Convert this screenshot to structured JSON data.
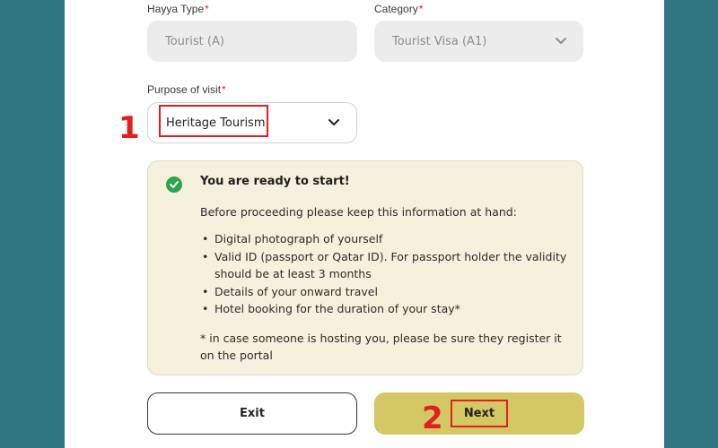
{
  "form": {
    "hayya_type": {
      "label": "Hayya Type",
      "required_mark": "*",
      "value": "Tourist (A)"
    },
    "category": {
      "label": "Category",
      "required_mark": "*",
      "value": "Tourist Visa (A1)"
    },
    "purpose": {
      "label": "Purpose of visit",
      "required_mark": "*",
      "value": "Heritage Tourism"
    }
  },
  "info": {
    "title": "You are ready to start!",
    "intro": "Before proceeding please keep this information at hand:",
    "items": [
      "Digital photograph of yourself",
      "Valid ID (passport or Qatar ID). For passport holder the validity should be at least 3 months",
      "Details of your onward travel",
      "Hotel booking for the duration of your stay*"
    ],
    "note": "* in case someone is hosting you, please be sure they register it on the portal"
  },
  "buttons": {
    "exit": "Exit",
    "next": "Next"
  },
  "annotations": {
    "step1": "1",
    "step2": "2"
  },
  "colors": {
    "background": "#2f7681",
    "next_button": "#d4c864",
    "info_box": "#f6f1dc",
    "highlight": "#e02020",
    "check": "#2da44e"
  }
}
